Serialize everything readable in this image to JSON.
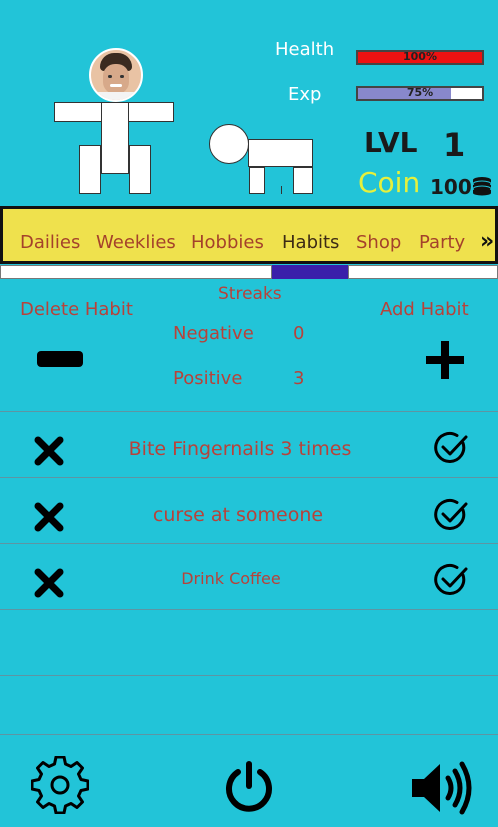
{
  "stats": {
    "health_label": "Health",
    "health_text": "100%",
    "health_percent": 100,
    "exp_label": "Exp",
    "exp_text": "75%",
    "exp_percent": 75,
    "level_label": "LVL",
    "level_value": "1",
    "coin_label": "Coin",
    "coin_value": "100"
  },
  "colors": {
    "background": "#22c4d8",
    "tab_bar": "#efe14d",
    "health_fill": "#ee1111",
    "exp_fill": "#8888cc",
    "active_indicator": "#3a1faa",
    "coin_label": "#e6f03c",
    "accent_text": "#b8423a"
  },
  "tabs": [
    {
      "label": "Dailies"
    },
    {
      "label": "Weeklies"
    },
    {
      "label": "Hobbies"
    },
    {
      "label": "Habits",
      "active": true
    },
    {
      "label": "Shop"
    },
    {
      "label": "Party"
    }
  ],
  "habits_panel": {
    "delete_label": "Delete Habit",
    "add_label": "Add Habit",
    "streaks_label": "Streaks",
    "negative_label": "Negative",
    "negative_value": "0",
    "positive_label": "Positive",
    "positive_value": "3"
  },
  "habits": [
    {
      "name": "Bite Fingernails 3 times"
    },
    {
      "name": "curse at someone"
    },
    {
      "name": "Drink Coffee"
    }
  ],
  "icons": {
    "avatar": "avatar-photo",
    "tabs_more": "double-chevron-right-icon",
    "delete": "minus-icon",
    "add": "plus-icon",
    "fail": "x-icon",
    "complete": "check-circle-icon",
    "settings": "gear-icon",
    "power": "power-icon",
    "sound": "speaker-icon",
    "coins": "coin-stack-icon"
  }
}
